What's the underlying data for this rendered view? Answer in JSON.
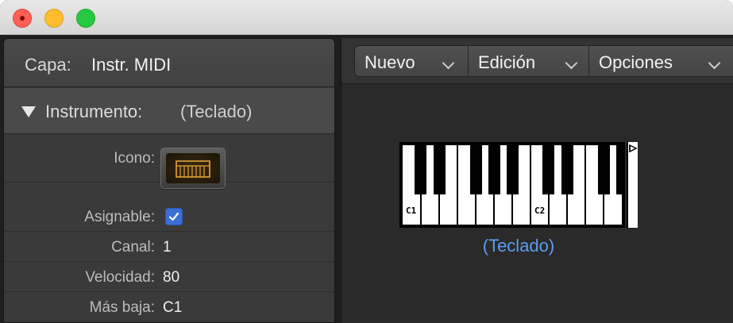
{
  "window": {
    "buttons": [
      "close",
      "minimize",
      "maximize"
    ]
  },
  "inspector": {
    "layer_label": "Capa:",
    "layer_value": "Instr. MIDI",
    "section_label": "Instrumento:",
    "section_value": "(Teclado)",
    "params": [
      {
        "label": "Icono:",
        "value": ""
      },
      {
        "label": "Asignable:",
        "value": ""
      },
      {
        "label": "Canal:",
        "value": "1"
      },
      {
        "label": "Velocidad:",
        "value": "80"
      },
      {
        "label": "Más baja:",
        "value": "C1"
      }
    ],
    "icon_name": "keyboard-icon",
    "assignable_checked": true
  },
  "toolbar": {
    "menus": [
      {
        "label": "Nuevo"
      },
      {
        "label": "Edición"
      },
      {
        "label": "Opciones"
      }
    ]
  },
  "canvas": {
    "object_label": "(Teclado)",
    "octave_labels": [
      "C1",
      "C2"
    ],
    "link_color": "#5b9cf0"
  }
}
